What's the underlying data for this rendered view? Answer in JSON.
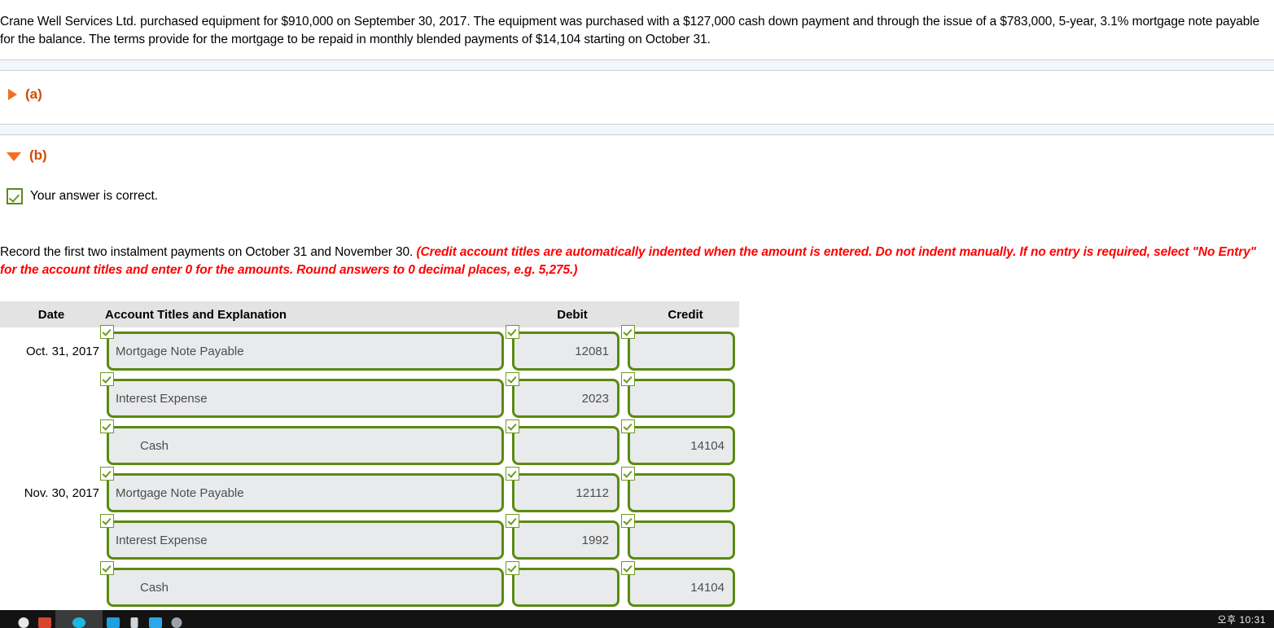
{
  "problem": {
    "intro": "Crane Well Services Ltd. purchased equipment for $910,000 on September 30, 2017. The equipment was purchased with a $127,000 cash down payment and through the issue of a $783,000, 5-year, 3.1% mortgage note payable for the balance. The terms provide for the mortgage to be repaid in monthly blended payments of $14,104 starting on October 31."
  },
  "sections": {
    "a": {
      "label": "(a)",
      "state": "collapsed",
      "triangle": "triangle-right-icon"
    },
    "b": {
      "label": "(b)",
      "state": "expanded",
      "triangle": "triangle-down-icon"
    }
  },
  "feedback": {
    "icon": "green-check-icon",
    "text": "Your answer is correct."
  },
  "instruction": {
    "plain": "Record the first two instalment payments on October 31 and November 30. ",
    "hint": "(Credit account titles are automatically indented when the amount is entered. Do not indent manually. If no entry is required, select \"No Entry\" for the account titles and enter 0 for the amounts. Round answers to 0 decimal places, e.g. 5,275.)"
  },
  "journal": {
    "columns": {
      "date": "Date",
      "account": "Account Titles and Explanation",
      "debit": "Debit",
      "credit": "Credit"
    },
    "rows": [
      {
        "date": "Oct. 31, 2017",
        "account": "Mortgage Note Payable",
        "indented": false,
        "debit": "12081",
        "credit": ""
      },
      {
        "date": "",
        "account": "Interest Expense",
        "indented": false,
        "debit": "2023",
        "credit": ""
      },
      {
        "date": "",
        "account": "Cash",
        "indented": true,
        "debit": "",
        "credit": "14104"
      },
      {
        "date": "Nov. 30, 2017",
        "account": "Mortgage Note Payable",
        "indented": false,
        "debit": "12112",
        "credit": ""
      },
      {
        "date": "",
        "account": "Interest Expense",
        "indented": false,
        "debit": "1992",
        "credit": ""
      },
      {
        "date": "",
        "account": "Cash",
        "indented": true,
        "debit": "",
        "credit": "14104"
      }
    ],
    "validation_badge": "green-check-icon"
  },
  "taskbar": {
    "clock": "오후 10:31",
    "icons": [
      "start-icon",
      "search-icon",
      "browser-active-icon",
      "app-blue-icon",
      "app-gray-icon",
      "app-cyan-icon",
      "app-circle-icon"
    ]
  },
  "colors": {
    "accent_orange": "#f36f21",
    "header_orange": "#d14900",
    "validation_green": "#5b8a12",
    "hint_red": "#ff0000",
    "field_bg": "#e9eaec",
    "table_header_bg": "#e3e3e3"
  }
}
